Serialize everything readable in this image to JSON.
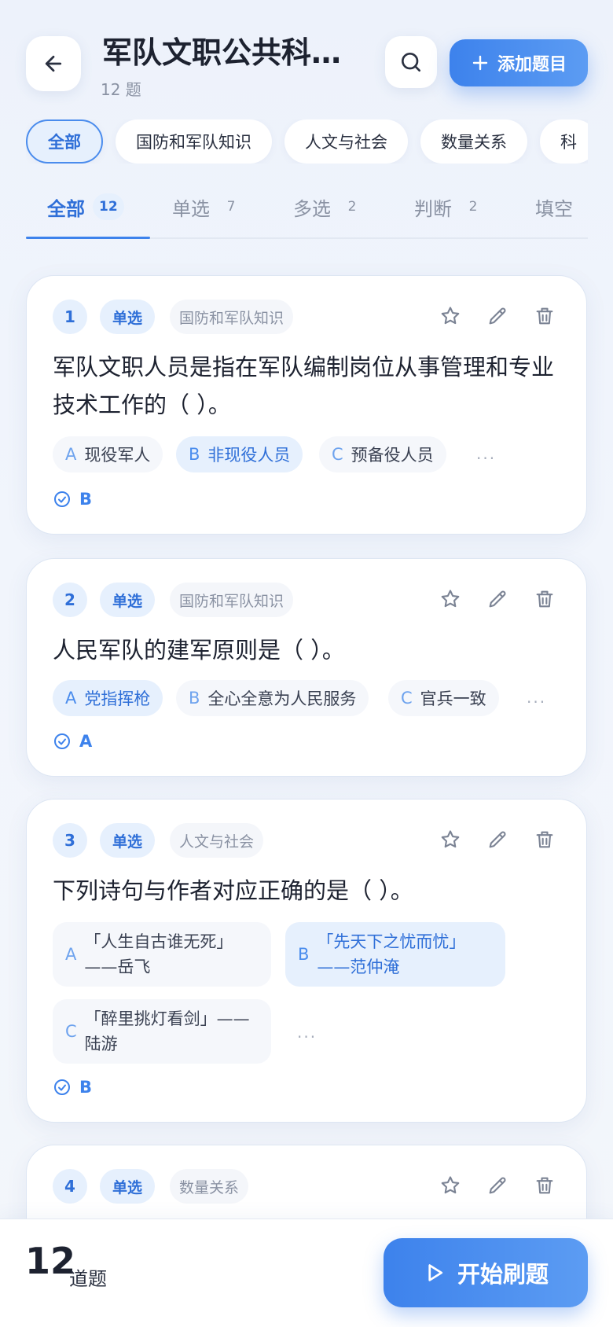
{
  "header": {
    "title": "军队文职公共科目...",
    "subtitle": "12 题",
    "add_label": "添加题目"
  },
  "categories": [
    "全部",
    "国防和军队知识",
    "人文与社会",
    "数量关系",
    "科"
  ],
  "tabs": [
    {
      "label": "全部",
      "count": "12"
    },
    {
      "label": "单选",
      "count": "7"
    },
    {
      "label": "多选",
      "count": "2"
    },
    {
      "label": "判断",
      "count": "2"
    },
    {
      "label": "填空",
      "count": ""
    }
  ],
  "questions": [
    {
      "num": "1",
      "type": "单选",
      "category": "国防和军队知识",
      "stem": "军队文职人员是指在军队编制岗位从事管理和专业技术工作的（ ）。",
      "options": [
        {
          "key": "A",
          "text": "现役军人"
        },
        {
          "key": "B",
          "text": "非现役人员"
        },
        {
          "key": "C",
          "text": "预备役人员"
        }
      ],
      "more": "...",
      "answer": "B"
    },
    {
      "num": "2",
      "type": "单选",
      "category": "国防和军队知识",
      "stem": "人民军队的建军原则是（ ）。",
      "options": [
        {
          "key": "A",
          "text": "党指挥枪"
        },
        {
          "key": "B",
          "text": "全心全意为人民服务"
        },
        {
          "key": "C",
          "text": "官兵一致"
        }
      ],
      "more": "...",
      "answer": "A"
    },
    {
      "num": "3",
      "type": "单选",
      "category": "人文与社会",
      "stem": "下列诗句与作者对应正确的是（ ）。",
      "options": [
        {
          "key": "A",
          "line1": "「人生自古谁无死」",
          "line2": "——岳飞"
        },
        {
          "key": "B",
          "line1": "「先天下之忧而忧」",
          "line2": "——范仲淹"
        },
        {
          "key": "C",
          "line1": "「醉里挑灯看剑」——",
          "line2": "陆游"
        }
      ],
      "more": "...",
      "answer": "B"
    },
    {
      "num": "4",
      "type": "单选",
      "category": "数量关系"
    }
  ],
  "footer": {
    "total": "12",
    "total_label": "道题",
    "start_label": "开始刷题"
  },
  "colors": {
    "accent": "#3d82ec",
    "accent_light": "#e6f0fd",
    "text": "#1d2230",
    "muted": "#8a92a3"
  }
}
